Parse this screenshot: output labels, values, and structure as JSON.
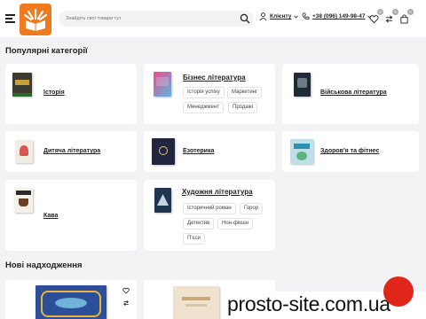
{
  "header": {
    "search_placeholder": "Знайдіть свої товари тут",
    "login_label": "Клієнту",
    "phone": "+38 (096) 149-98-47",
    "badges": {
      "favorites": "0",
      "compare": "0",
      "cart": "0"
    }
  },
  "sections": {
    "popular_title": "Популярні категорії",
    "new_title": "Нові надходження"
  },
  "categories": [
    {
      "name": "Історія"
    },
    {
      "name": "Бізнес література",
      "subs": [
        "Історія успіху",
        "Маркетинг",
        "Менеджмент",
        "Продажі"
      ]
    },
    {
      "name": "Військова література"
    },
    {
      "name": "Дитяча література"
    },
    {
      "name": "Езотерика"
    },
    {
      "name": "Здоров'я та фітнес"
    },
    {
      "name": "Кава"
    },
    {
      "name": "Художня література",
      "subs": [
        "Історичний роман",
        "Горор",
        "Детектив",
        "Нон-фікшн",
        "П'єси"
      ]
    }
  ],
  "watermark": "prosto-site.com.ua",
  "colors": {
    "brand": "#f07a1e",
    "accent": "#e0251b",
    "background": "#f3f3f5"
  }
}
